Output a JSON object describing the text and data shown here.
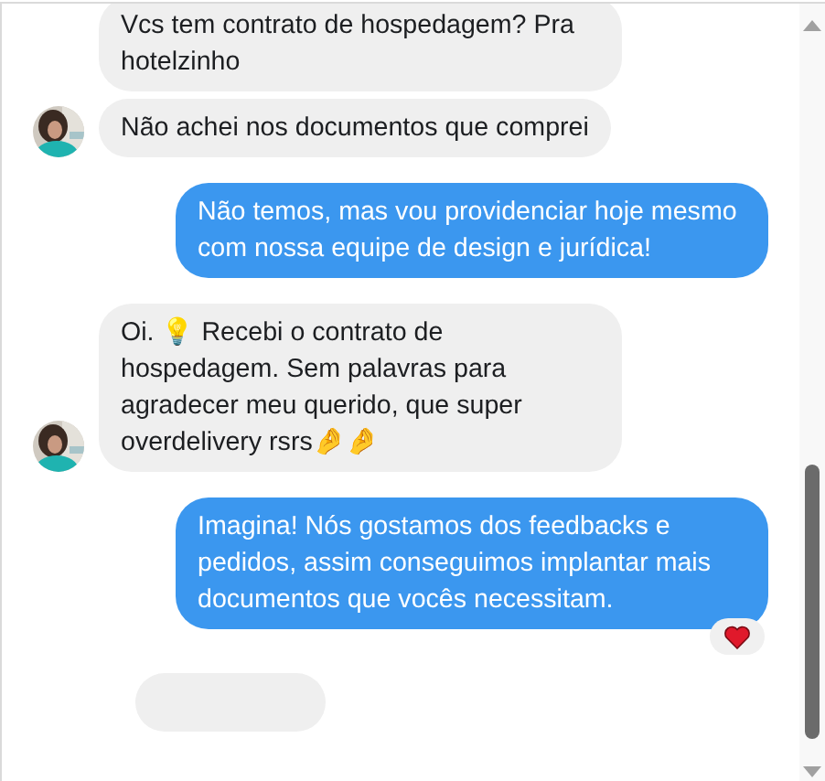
{
  "messages": [
    {
      "kind": "received",
      "text": "Vcs tem contrato de hospedagem? Pra hotelzinho",
      "avatar": false
    },
    {
      "kind": "received",
      "text": "Não achei nos documentos que comprei",
      "avatar": true
    },
    {
      "kind": "sent",
      "text": "Não temos, mas vou providenciar hoje mesmo com nossa equipe de design e jurídica!"
    },
    {
      "kind": "received",
      "text": "Oi. 💡 Recebi o contrato de hospedagem. Sem palavras para agradecer meu querido, que super overdelivery rsrs🤌🤌",
      "avatar": true
    },
    {
      "kind": "sent",
      "text": "Imagina! Nós gostamos dos feedbacks e pedidos, assim conseguimos implantar mais documentos que vocês necessitam.",
      "reactions": [
        {
          "kind": "heart"
        }
      ]
    },
    {
      "kind": "received",
      "avatar": false
    }
  ]
}
